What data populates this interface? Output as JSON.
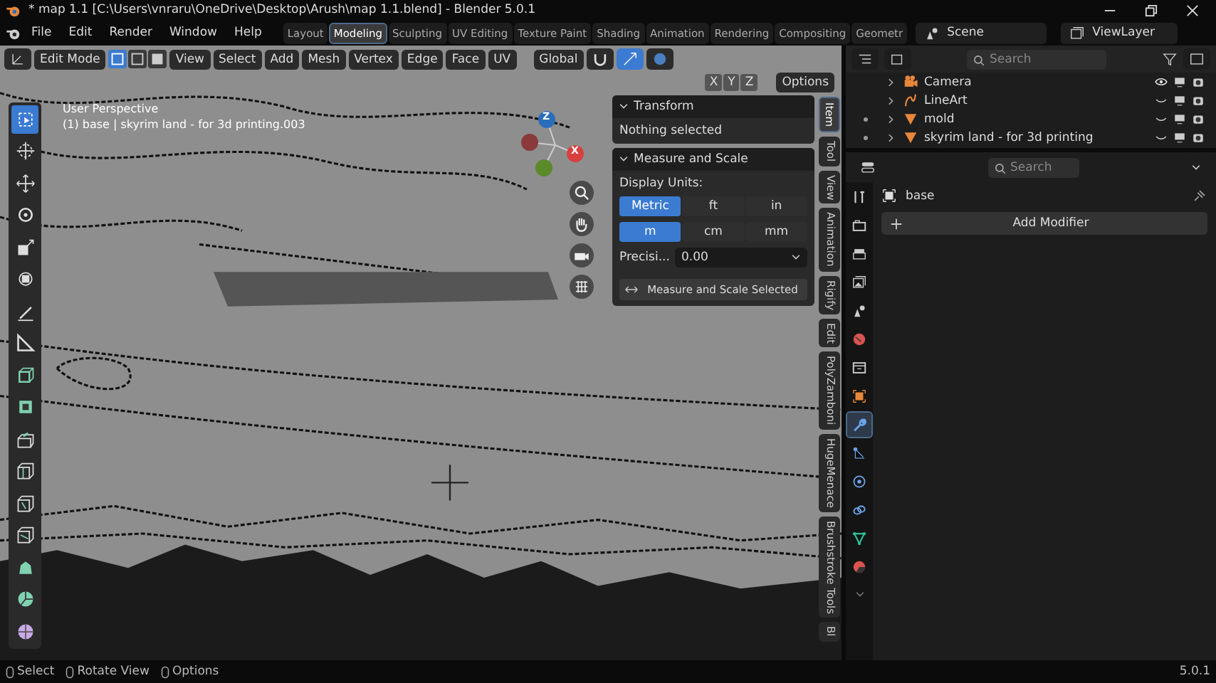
{
  "window": {
    "title": "* map 1.1 [C:\\Users\\vnraru\\OneDrive\\Desktop\\Arush\\map 1.1.blend] - Blender 5.0.1"
  },
  "menu": [
    "File",
    "Edit",
    "Render",
    "Window",
    "Help"
  ],
  "workspaces": [
    {
      "label": "Layout",
      "selected": false
    },
    {
      "label": "Modeling",
      "selected": true
    },
    {
      "label": "Sculpting",
      "selected": false
    },
    {
      "label": "UV Editing",
      "selected": false
    },
    {
      "label": "Texture Paint",
      "selected": false
    },
    {
      "label": "Shading",
      "selected": false
    },
    {
      "label": "Animation",
      "selected": false
    },
    {
      "label": "Rendering",
      "selected": false
    },
    {
      "label": "Compositing",
      "selected": false
    },
    {
      "label": "Geometr",
      "selected": false
    }
  ],
  "scene": "Scene",
  "view_layer": "ViewLayer",
  "viewport": {
    "mode": "Edit Mode",
    "menus": [
      "View",
      "Select",
      "Add",
      "Mesh",
      "Vertex",
      "Edge",
      "Face",
      "UV"
    ],
    "orientation": "Global",
    "axes": [
      "X",
      "Y",
      "Z"
    ],
    "options": "Options",
    "overlay_lines": [
      "User Perspective",
      "(1) base | skyrim land - for 3d printing.003"
    ],
    "gizmo_axes": [
      "Z",
      "X"
    ],
    "tools": [
      {
        "kind": "select",
        "selected": true
      },
      {
        "kind": "cursor",
        "selected": false
      },
      {
        "kind": "move",
        "selected": false
      },
      {
        "kind": "rotate",
        "selected": false
      },
      {
        "kind": "scale",
        "selected": false
      },
      {
        "kind": "transform",
        "selected": false
      },
      {
        "kind": "annotate",
        "selected": false
      },
      {
        "kind": "measure",
        "selected": false
      },
      {
        "kind": "add-cube",
        "selected": false
      },
      {
        "kind": "extrude",
        "selected": false
      },
      {
        "kind": "inset",
        "selected": false
      },
      {
        "kind": "bevel",
        "selected": false
      },
      {
        "kind": "loop-cut",
        "selected": false
      },
      {
        "kind": "knife",
        "selected": false
      },
      {
        "kind": "poly-build",
        "selected": false
      },
      {
        "kind": "spin",
        "selected": false
      },
      {
        "kind": "sphere",
        "selected": false
      }
    ]
  },
  "sidebar": {
    "transform": {
      "title": "Transform",
      "note": "Nothing selected"
    },
    "measure": {
      "title": "Measure and Scale",
      "units_label": "Display Units:",
      "systems": [
        {
          "label": "Metric",
          "selected": true
        },
        {
          "label": "ft",
          "selected": false
        },
        {
          "label": "in",
          "selected": false
        }
      ],
      "units": [
        {
          "label": "m",
          "selected": true
        },
        {
          "label": "cm",
          "selected": false
        },
        {
          "label": "mm",
          "selected": false
        }
      ],
      "precision_label": "Precisi...",
      "precision_value": "0.00",
      "button": "Measure and Scale Selected"
    },
    "tabs": [
      {
        "label": "Item",
        "selected": true
      },
      {
        "label": "Tool",
        "selected": false
      },
      {
        "label": "View",
        "selected": false
      },
      {
        "label": "Animation",
        "selected": false
      },
      {
        "label": "Rigify",
        "selected": false
      },
      {
        "label": "Edit",
        "selected": false
      },
      {
        "label": "PolyZamboni",
        "selected": false
      },
      {
        "label": "HugeMenace",
        "selected": false
      },
      {
        "label": "Brushstroke Tools",
        "selected": false
      },
      {
        "label": "Bl",
        "selected": false
      }
    ]
  },
  "outliner": {
    "search_placeholder": "Search",
    "items": [
      {
        "name": "Camera",
        "kind": "camera",
        "visible": true,
        "editing": false
      },
      {
        "name": "LineArt",
        "kind": "lineart",
        "visible": false,
        "editing": false
      },
      {
        "name": "mold",
        "kind": "mesh",
        "visible": false,
        "editing": true
      },
      {
        "name": "skyrim land - for 3d printing",
        "kind": "mesh",
        "visible": false,
        "editing": true
      }
    ]
  },
  "properties": {
    "search_placeholder": "Search",
    "object": "base",
    "add_modifier": "Add Modifier",
    "tabs": [
      {
        "kind": "tool",
        "selected": false
      },
      {
        "kind": "render",
        "selected": false
      },
      {
        "kind": "output",
        "selected": false
      },
      {
        "kind": "view-layer",
        "selected": false
      },
      {
        "kind": "scene",
        "selected": false
      },
      {
        "kind": "world",
        "selected": false
      },
      {
        "kind": "collection",
        "selected": false
      },
      {
        "kind": "object",
        "selected": false
      },
      {
        "kind": "modifiers",
        "selected": true
      },
      {
        "kind": "particles",
        "selected": false
      },
      {
        "kind": "physics",
        "selected": false
      },
      {
        "kind": "constraints",
        "selected": false
      },
      {
        "kind": "data",
        "selected": false
      },
      {
        "kind": "material",
        "selected": false
      }
    ]
  },
  "status_bar": {
    "hints": [
      "Select",
      "Rotate View",
      "Options"
    ],
    "version": "5.0.1"
  }
}
